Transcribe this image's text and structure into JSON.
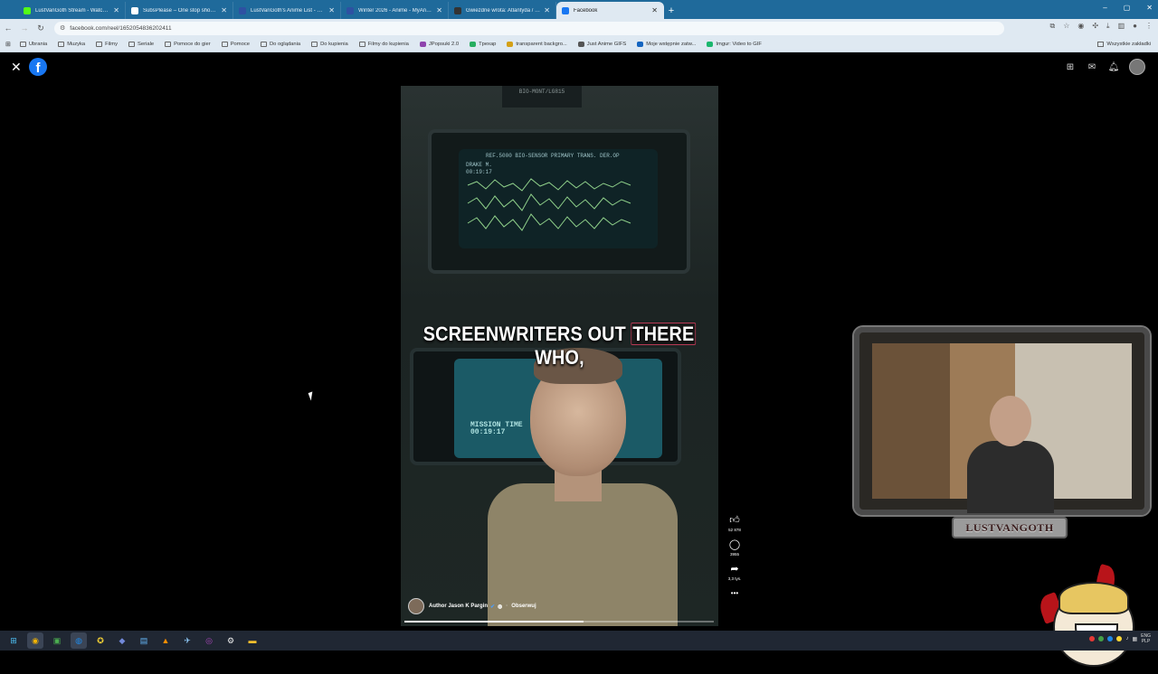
{
  "browser": {
    "tabs": [
      {
        "label": "LustVanGoth Stream - Watch Li...",
        "color": "#53fc18",
        "active": false
      },
      {
        "label": "SubsPlease – One stop shop fo...",
        "color": "#ffffff",
        "active": false
      },
      {
        "label": "LustVanGoth's Anime List - My...",
        "color": "#2e51a2",
        "active": false
      },
      {
        "label": "Winter 2026 - Anime - MyAnim...",
        "color": "#2e51a2",
        "active": false
      },
      {
        "label": "Gwiezdne wrota: Atlantyda / St...",
        "color": "#333333",
        "active": false
      },
      {
        "label": "Facebook",
        "color": "#1877f2",
        "active": true
      }
    ],
    "new_tab_label": "+",
    "url": "facebook.com/reel/1652054836202411",
    "bookmarks": [
      {
        "label": "Ubrania",
        "icon": "folder-icon"
      },
      {
        "label": "Muzyka",
        "icon": "folder-icon"
      },
      {
        "label": "Filmy",
        "icon": "folder-icon"
      },
      {
        "label": "Seriale",
        "icon": "folder-icon"
      },
      {
        "label": "Pomoce do gier",
        "icon": "folder-icon"
      },
      {
        "label": "Pomoce",
        "icon": "folder-icon"
      },
      {
        "label": "Do oglądania",
        "icon": "folder-icon"
      },
      {
        "label": "Do kupienia",
        "icon": "folder-icon"
      },
      {
        "label": "Filmy do kupienia",
        "icon": "folder-icon"
      },
      {
        "label": "JPopsuki 2.0",
        "icon": "site-icon",
        "color": "#8e44ad"
      },
      {
        "label": "Tpexap",
        "icon": "site-icon",
        "color": "#27ae60"
      },
      {
        "label": "transparent backgro...",
        "icon": "site-icon",
        "color": "#d4a017"
      },
      {
        "label": "Just Anime GIFS",
        "icon": "site-icon",
        "color": "#555555"
      },
      {
        "label": "Moje wstępnie zatw...",
        "icon": "site-icon",
        "color": "#1565c0"
      },
      {
        "label": "Imgur: Video to GIF",
        "icon": "site-icon",
        "color": "#1bb76e"
      }
    ],
    "all_bookmarks_label": "Wszystkie zakładki"
  },
  "reel": {
    "caption_before": "SCREENWRITERS OUT ",
    "caption_highlight": "THERE",
    "caption_after": " WHO,",
    "label_plate": "BIO-MONT/LG815",
    "screen_header": "REF.5000 BIO-SENSOR PRIMARY TRANS. DER.OP",
    "screen_name": "DRAKE M.",
    "screen_time": "00:19:17",
    "screen2_line1": "MISSION TIME",
    "screen2_line2": "00:19:17",
    "author": "Author Jason K Pargin",
    "follow_label": "Obserwuj",
    "progress": 0.58,
    "likes": "52 878",
    "comments": "3955",
    "shares": "3,3 tys.",
    "more_label": "•••"
  },
  "overlay": {
    "streamer_name": "LUSTVANGOTH"
  },
  "colors": {
    "tabstrip": "#1f6a9b",
    "chrome": "#dfe9f2",
    "facebook_blue": "#1877f2",
    "taskbar": "#202733"
  }
}
